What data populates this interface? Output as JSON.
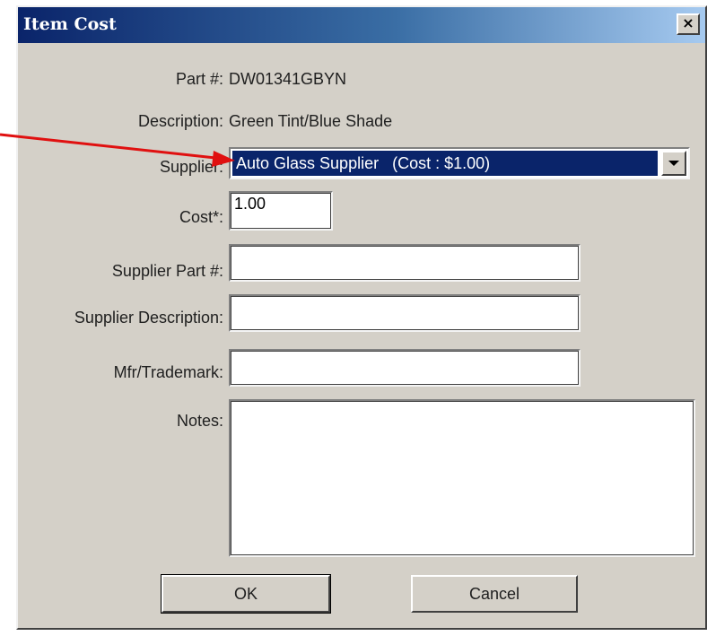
{
  "dialog": {
    "title": "Item Cost",
    "close_glyph": "×"
  },
  "fields": {
    "part_label": "Part #:",
    "part_value": "DW01341GBYN",
    "description_label": "Description:",
    "description_value": "Green Tint/Blue Shade",
    "supplier_label": "Supplier:",
    "supplier_value": "Auto Glass Supplier   (Cost : $1.00)",
    "cost_label": "Cost*:",
    "cost_value": "1.00",
    "supplier_part_label": "Supplier Part #:",
    "supplier_part_value": "",
    "supplier_description_label": "Supplier Description:",
    "supplier_description_value": "",
    "mfr_label": "Mfr/Trademark:",
    "mfr_value": "",
    "notes_label": "Notes:",
    "notes_value": ""
  },
  "buttons": {
    "ok_label": "OK",
    "cancel_label": "Cancel"
  },
  "annotation": {
    "arrow_color": "#e01010"
  },
  "colors": {
    "titlebar_start": "#0a246a",
    "selection": "#0a246a",
    "dialog_face": "#d4d0c8"
  },
  "icons": {
    "close": "close-icon",
    "dropdown": "chevron-down-icon"
  }
}
